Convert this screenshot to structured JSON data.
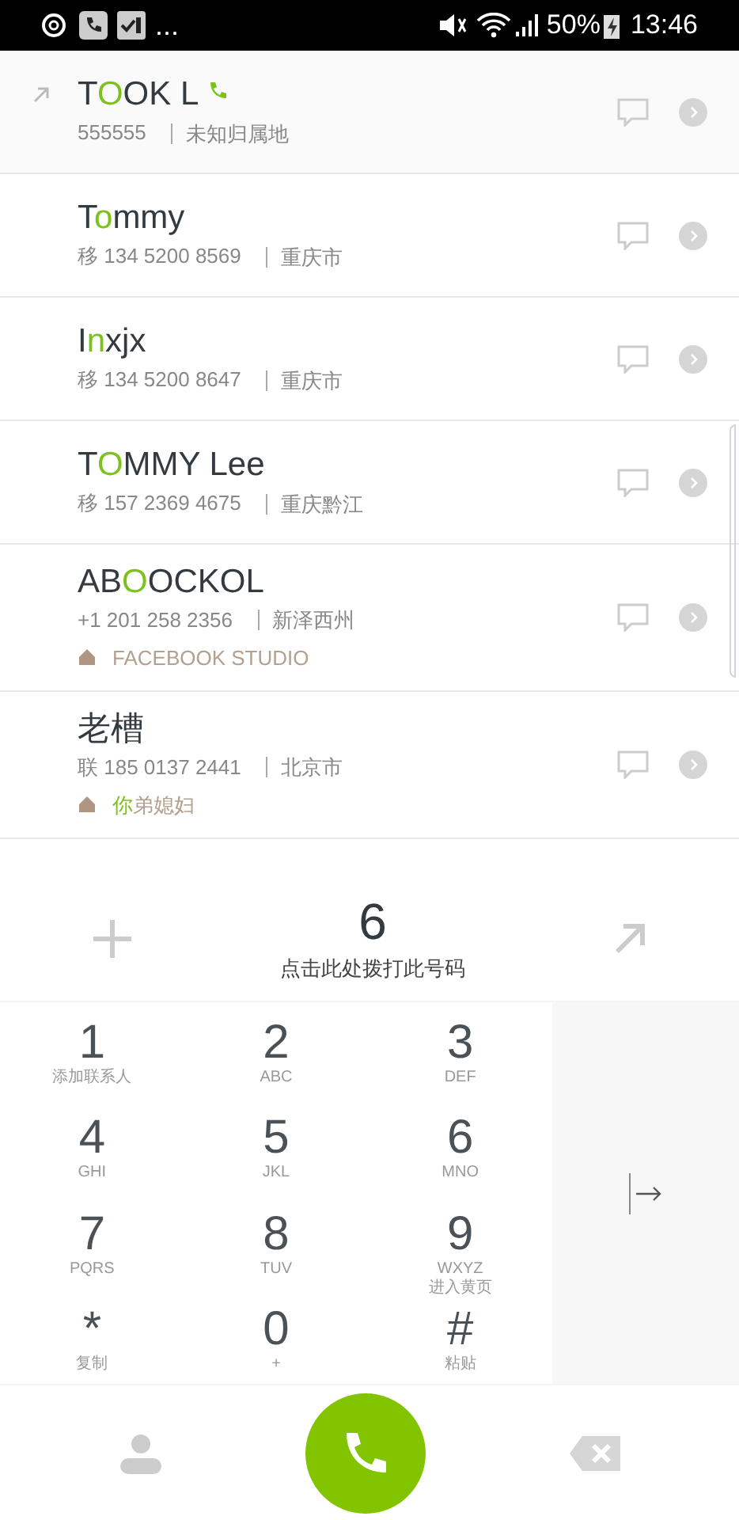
{
  "status_bar": {
    "overflow": "...",
    "battery": "50%",
    "time": "13:46"
  },
  "contacts": [
    {
      "name": {
        "before": "T",
        "match": "O",
        "after": "OK L"
      },
      "outgoing": true,
      "recent_call": true,
      "number": "555555",
      "location": "未知归属地"
    },
    {
      "name": {
        "before": "T",
        "match": "o",
        "after": "mmy"
      },
      "outgoing": false,
      "recent_call": false,
      "number": "移 134 5200 8569",
      "location": "重庆市"
    },
    {
      "name": {
        "before": "I",
        "match": "n",
        "after": "xjx"
      },
      "outgoing": false,
      "recent_call": false,
      "number": "移 134 5200 8647",
      "location": "重庆市"
    },
    {
      "name": {
        "before": "T",
        "match": "O",
        "after": "MMY Lee"
      },
      "outgoing": false,
      "recent_call": false,
      "number": "移 157 2369 4675",
      "location": "重庆黔江"
    },
    {
      "name": {
        "before": "AB",
        "match": "O",
        "after": "OCKOL"
      },
      "outgoing": false,
      "recent_call": false,
      "number": "+1 201 258 2356",
      "location": "新泽西州",
      "note": {
        "after": "FACEBOOK STUDIO"
      }
    },
    {
      "name": {
        "before": "老槽"
      },
      "outgoing": false,
      "recent_call": false,
      "number": "联 185 0137 2441",
      "location": "北京市",
      "note": {
        "match": "你",
        "after": "弟媳妇"
      }
    }
  ],
  "dialer": {
    "number": "6",
    "hint": "点击此处拨打此号码",
    "keys": [
      {
        "digit": "1",
        "sub": "添加联系人"
      },
      {
        "digit": "2",
        "sub": "ABC"
      },
      {
        "digit": "3",
        "sub": "DEF"
      },
      {
        "digit": "4",
        "sub": "GHI"
      },
      {
        "digit": "5",
        "sub": "JKL"
      },
      {
        "digit": "6",
        "sub": "MNO"
      },
      {
        "digit": "7",
        "sub": "PQRS"
      },
      {
        "digit": "8",
        "sub": "TUV"
      },
      {
        "digit": "9",
        "sub": "WXYZ",
        "extra": "进入黄页"
      },
      {
        "digit": "*",
        "sub": "复制"
      },
      {
        "digit": "0",
        "sub": "+"
      },
      {
        "digit": "#",
        "sub": "粘贴"
      }
    ]
  }
}
